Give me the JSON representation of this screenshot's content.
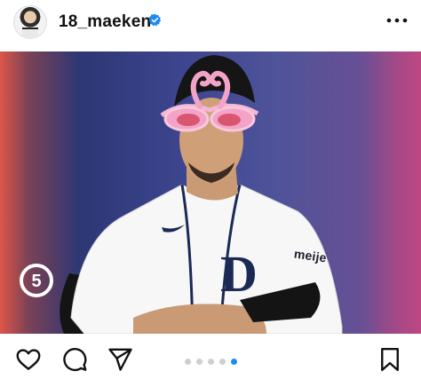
{
  "post": {
    "username": "18_maeken",
    "verified": true,
    "avatar_icon": "profile-avatar",
    "more_icon": "more-options-icon"
  },
  "photo": {
    "channel_logo_text": "5",
    "jersey_text": "meije",
    "colors": {
      "backdrop": "#3e4690",
      "flare_left": "#ff5f46",
      "jersey": "#ffffff",
      "glasses": "#f4a3c8"
    }
  },
  "carousel": {
    "total": 5,
    "active_index": 4,
    "active_color": "#1c8cf0",
    "inactive_color": "#cfcfcf"
  },
  "actions": {
    "like_icon": "heart-icon",
    "comment_icon": "comment-icon",
    "share_icon": "send-icon",
    "save_icon": "bookmark-icon"
  }
}
